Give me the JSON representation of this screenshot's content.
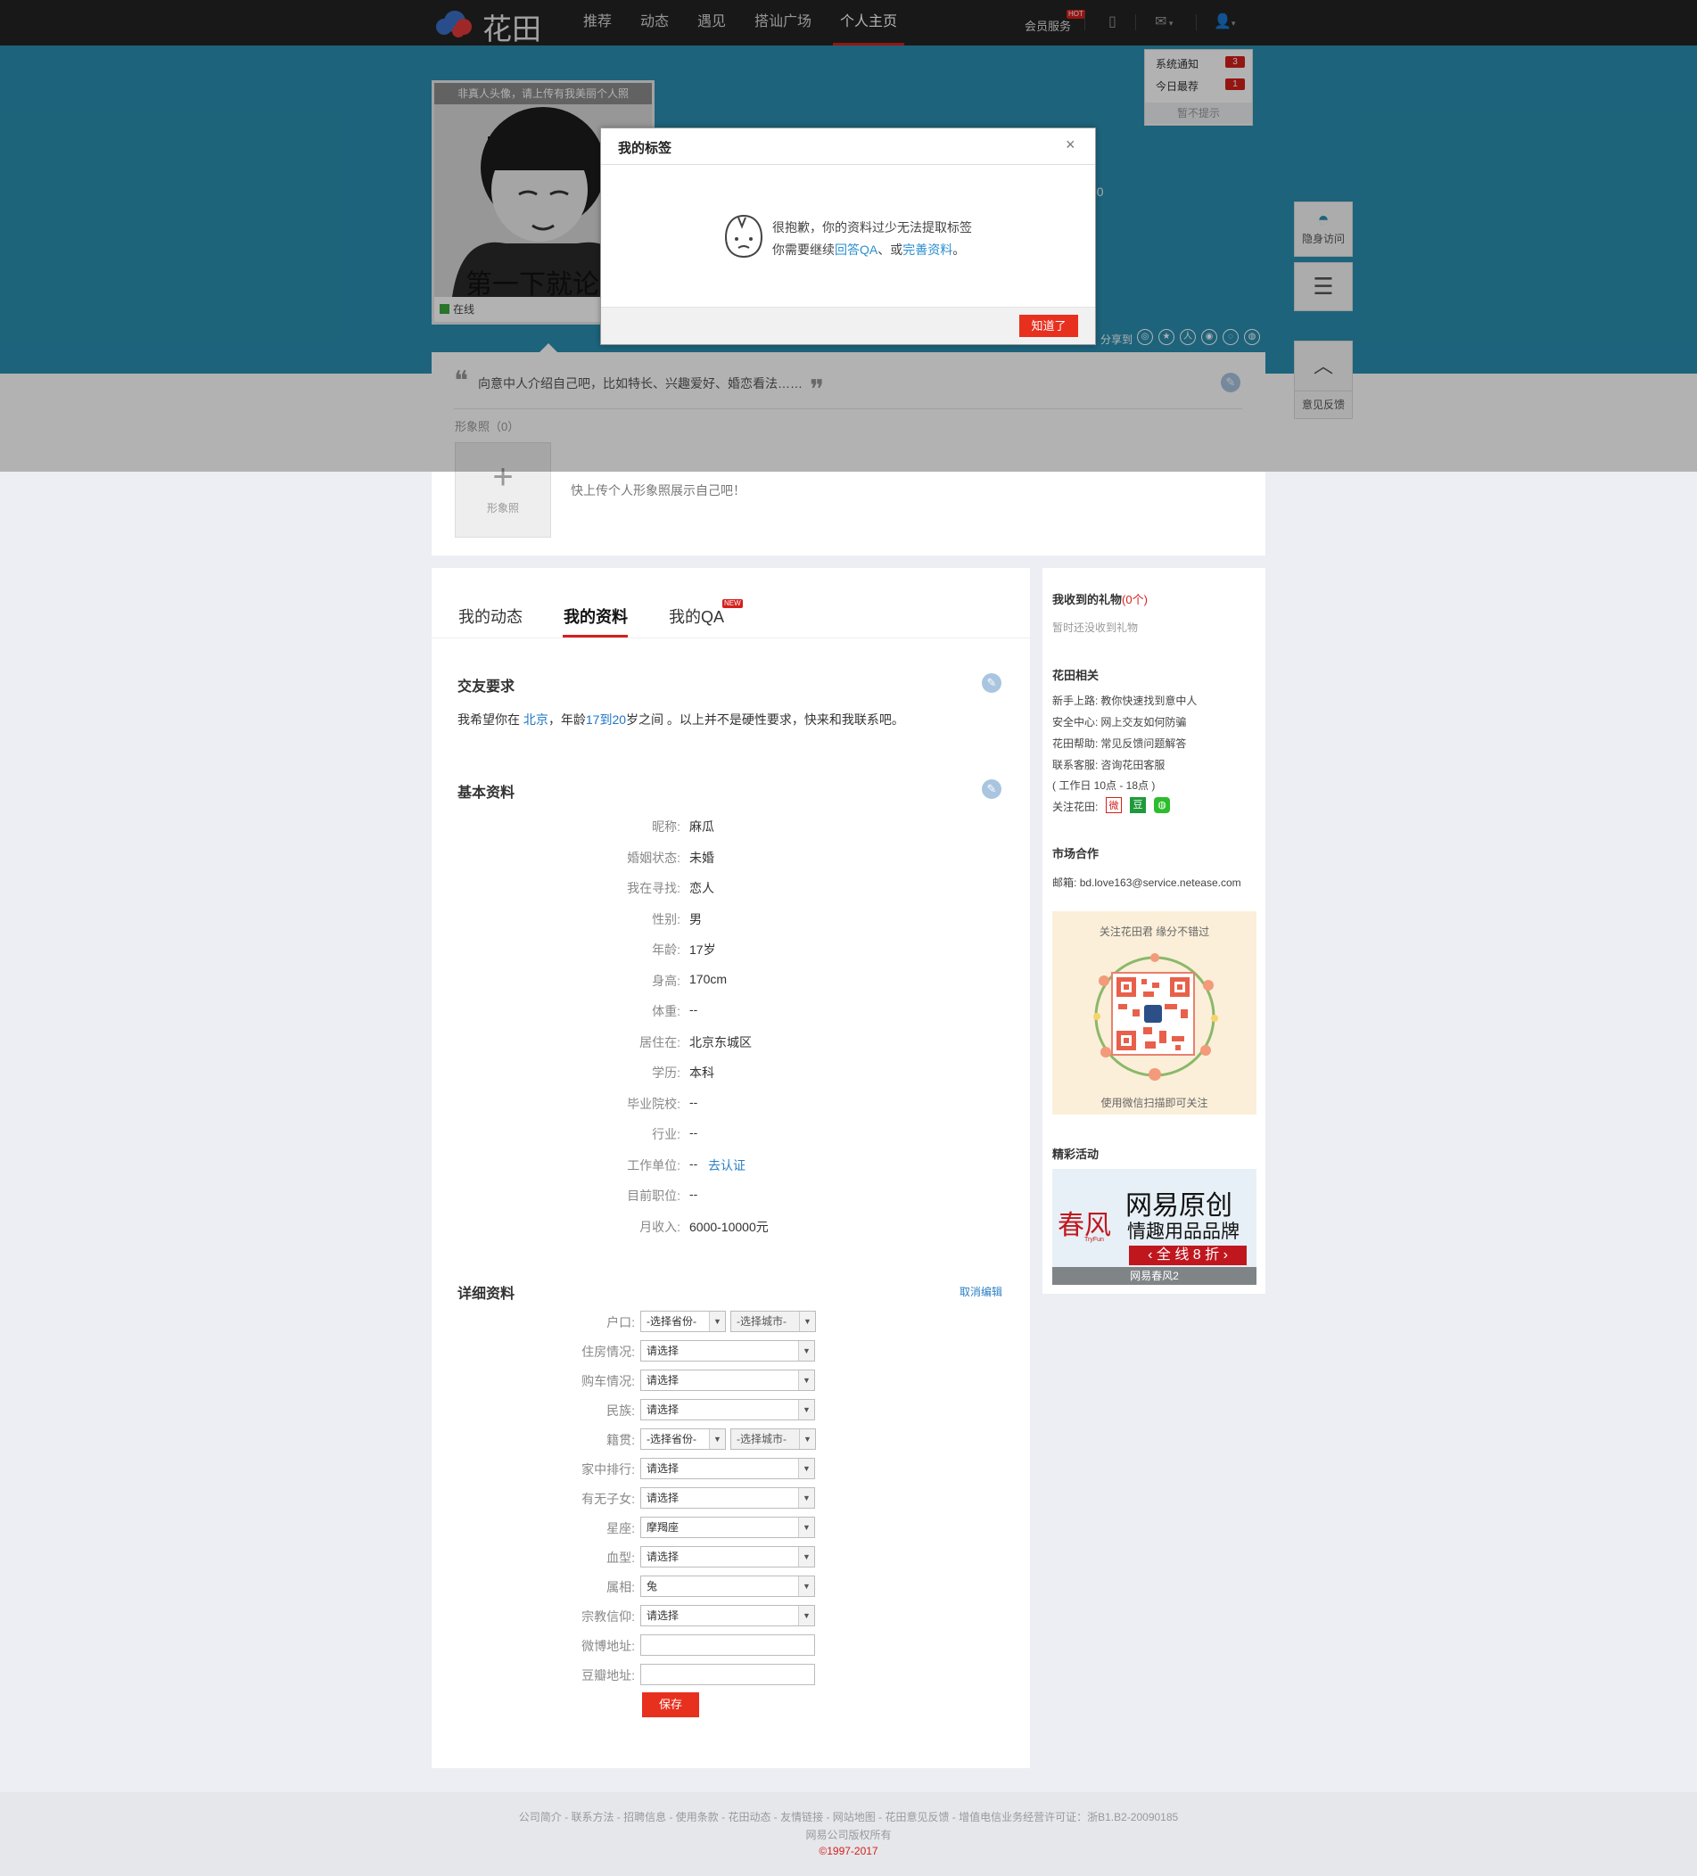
{
  "header": {
    "logo_text": "花田",
    "nav": [
      "推荐",
      "动态",
      "遇见",
      "搭讪广场",
      "个人主页"
    ],
    "member_service": "会员服务",
    "hot_badge": "HOT"
  },
  "notifications": {
    "items": [
      {
        "label": "系统通知",
        "count": "3"
      },
      {
        "label": "今日最荐",
        "count": "1"
      }
    ],
    "footer": "暂不提示"
  },
  "profile": {
    "avatar_tip": "非真人头像，请上传有我美丽个人照",
    "avatar_caption": "第一下就论",
    "online_status": "在线",
    "share_label": "分享到",
    "intro_placeholder": "向意中人介绍自己吧，比如特长、兴趣爱好、婚恋看法……",
    "photo_label": "形象照（0）",
    "photo_add_label": "形象照",
    "photo_tip": "快上传个人形象照展示自己吧！",
    "height_fragment": "70"
  },
  "side_buttons": {
    "invisible_visit": "隐身访问",
    "feedback": "意见反馈"
  },
  "modal": {
    "title": "我的标签",
    "line1": "很抱歉，你的资料过少无法提取标签",
    "line2_pre": "你需要继续",
    "link_qa": "回答QA",
    "line2_mid": "、或",
    "link_profile": "完善资料",
    "line2_end": "。",
    "ok_button": "知道了"
  },
  "tabs": {
    "items": [
      "我的动态",
      "我的资料",
      "我的QA"
    ],
    "new_badge": "NEW"
  },
  "friend_requirement": {
    "title": "交友要求",
    "text_pre": "我希望你在 ",
    "city": "北京",
    "text_mid": "，年龄",
    "age_from": "17",
    "age_to_word": "到",
    "age_to": "20",
    "text_end": "岁之间 。以上并不是硬性要求，快来和我联系吧。"
  },
  "basic_info": {
    "title": "基本资料",
    "rows": [
      {
        "label": "昵称:",
        "value": "麻瓜"
      },
      {
        "label": "婚姻状态:",
        "value": "未婚"
      },
      {
        "label": "我在寻找:",
        "value": "恋人"
      },
      {
        "label": "性别:",
        "value": "男"
      },
      {
        "label": "年龄:",
        "value": "17岁"
      },
      {
        "label": "身高:",
        "value": "170cm"
      },
      {
        "label": "体重:",
        "value": "--"
      },
      {
        "label": "居住在:",
        "value": "北京东城区"
      },
      {
        "label": "学历:",
        "value": "本科"
      },
      {
        "label": "毕业院校:",
        "value": "--"
      },
      {
        "label": "行业:",
        "value": "--"
      },
      {
        "label": "工作单位:",
        "value": "--"
      },
      {
        "label": "目前职位:",
        "value": "--"
      },
      {
        "label": "月收入:",
        "value": "6000-10000元"
      }
    ],
    "verify_link": "去认证"
  },
  "detail_info": {
    "title": "详细资料",
    "cancel_edit": "取消编辑",
    "fields": [
      {
        "label": "户口:",
        "province": "-选择省份-",
        "city": "-选择城市-"
      },
      {
        "label": "住房情况:",
        "value": "请选择"
      },
      {
        "label": "购车情况:",
        "value": "请选择"
      },
      {
        "label": "民族:",
        "value": "请选择"
      },
      {
        "label": "籍贯:",
        "province": "-选择省份-",
        "city": "-选择城市-"
      },
      {
        "label": "家中排行:",
        "value": "请选择"
      },
      {
        "label": "有无子女:",
        "value": "请选择"
      },
      {
        "label": "星座:",
        "value": "摩羯座"
      },
      {
        "label": "血型:",
        "value": "请选择"
      },
      {
        "label": "属相:",
        "value": "兔"
      },
      {
        "label": "宗教信仰:",
        "value": "请选择"
      },
      {
        "label": "微博地址:",
        "value": ""
      },
      {
        "label": "豆瓣地址:",
        "value": ""
      }
    ],
    "save_button": "保存"
  },
  "sidebar": {
    "gifts_title": "我收到的礼物",
    "gifts_count": "(0个)",
    "gifts_empty": "暂时还没收到礼物",
    "related_title": "花田相关",
    "related": [
      {
        "label": "新手上路:",
        "link": "教你快速找到意中人"
      },
      {
        "label": "安全中心:",
        "link": "网上交友如何防骗"
      },
      {
        "label": "花田帮助:",
        "link": "常见反馈问题解答"
      },
      {
        "label": "联系客服:",
        "link": "咨询花田客服"
      }
    ],
    "hours": "( 工作日 10点 - 18点 )",
    "follow_label": "关注花田:",
    "market_title": "市场合作",
    "email_label": "邮箱:",
    "email": "bd.love163@service.netease.com",
    "qr_top": "关注花田君 缘分不错过",
    "qr_bottom": "使用微信扫描即可关注",
    "activity_title": "精彩活动",
    "promo_logo": "春风",
    "promo_logo_en": "TryFun",
    "promo_line1": "网易原创",
    "promo_line2": "情趣用品品牌",
    "promo_line3": "全 线 8 折",
    "promo_caption": "网易春风2"
  },
  "footer": {
    "links": "公司简介 - 联系方法 - 招聘信息 - 使用条款 - 花田动态 - 友情链接 - 网站地图 - 花田意见反馈 - 增值电信业务经营许可证：浙B1.B2-20090185",
    "rights": "网易公司版权所有",
    "copyright": "©1997-2017"
  },
  "colors": {
    "brand_red": "#d5201c",
    "banner_blue": "#2a8fb0",
    "link_blue": "#1c76c4"
  }
}
